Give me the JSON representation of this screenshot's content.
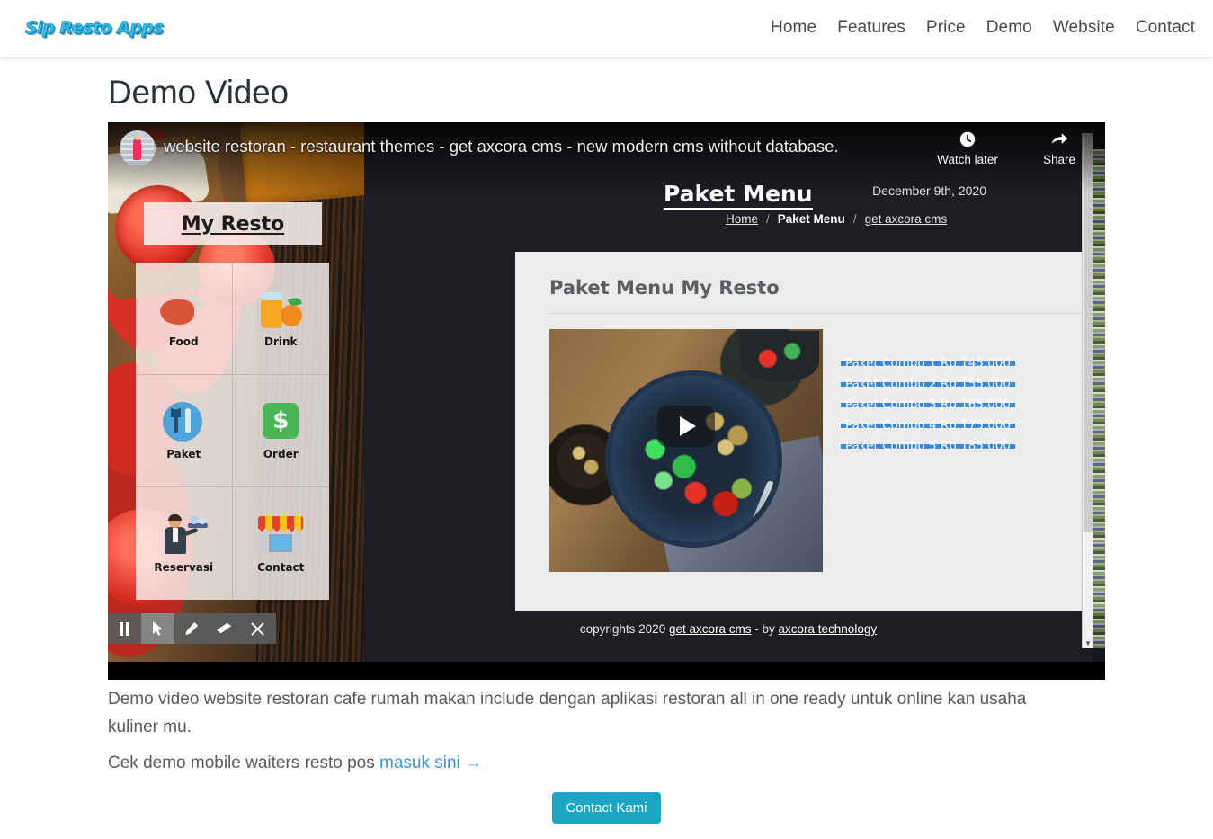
{
  "brand": "Sip Resto Apps",
  "nav": [
    {
      "label": "Home"
    },
    {
      "label": "Features"
    },
    {
      "label": "Price"
    },
    {
      "label": "Demo"
    },
    {
      "label": "Website"
    },
    {
      "label": "Contact"
    }
  ],
  "page": {
    "title": "Demo Video",
    "description": "Demo video website restoran cafe rumah makan include dengan aplikasi restoran all in one ready untuk online kan usaha kuliner mu.",
    "cek_text": "Cek demo mobile waiters resto pos ",
    "cek_link": "masuk sini →",
    "cta_label": "Contact Kami"
  },
  "video": {
    "title": "website restoran - restaurant themes - get axcora cms - new modern cms without database.",
    "watch_later_label": "Watch later",
    "share_label": "Share",
    "avatar_name": "channel-avatar"
  },
  "app_panel": {
    "title": "My Resto",
    "tiles": [
      {
        "label": "Food",
        "icon": "chicken-leg-icon"
      },
      {
        "label": "Drink",
        "icon": "juice-glass-icon"
      },
      {
        "label": "Paket",
        "icon": "cutlery-icon"
      },
      {
        "label": "Order",
        "icon": "dollar-icon"
      },
      {
        "label": "Reservasi",
        "icon": "waiter-icon"
      },
      {
        "label": "Contact",
        "icon": "storefront-icon"
      }
    ]
  },
  "site": {
    "heading": "Paket Menu",
    "date": "December 9th, 2020",
    "breadcrumb": {
      "home": "Home",
      "sep1": "/",
      "current": "Paket Menu",
      "sep2": "/",
      "source": "get axcora cms"
    },
    "card_heading": "Paket Menu My Resto",
    "combos": [
      {
        "label": "Paket Combo 1 Rp.145.000"
      },
      {
        "label": "Paket Combo 2 Rp.155.000"
      },
      {
        "label": "Paket Combo 3 Rp.165.000"
      },
      {
        "label": "Paket Combo 4 Rp.175.000"
      },
      {
        "label": "Paket Combo 5 Rp.185.000"
      }
    ],
    "footer": {
      "prefix": "copyrights 2020 ",
      "link1": "get axcora cms",
      "middle": " - by ",
      "link2": "axcora technology"
    }
  },
  "recorder": {
    "buttons": [
      {
        "name": "pause-icon"
      },
      {
        "name": "pointer-icon"
      },
      {
        "name": "pencil-icon"
      },
      {
        "name": "eraser-icon"
      },
      {
        "name": "close-icon"
      }
    ]
  },
  "colors": {
    "brand_cyan": "#2ec0f0",
    "cta_teal": "#1ba7c4",
    "link_blue": "#3b96e0",
    "selection_blue": "#3a87e0",
    "annotation_red": "#d2445c"
  }
}
